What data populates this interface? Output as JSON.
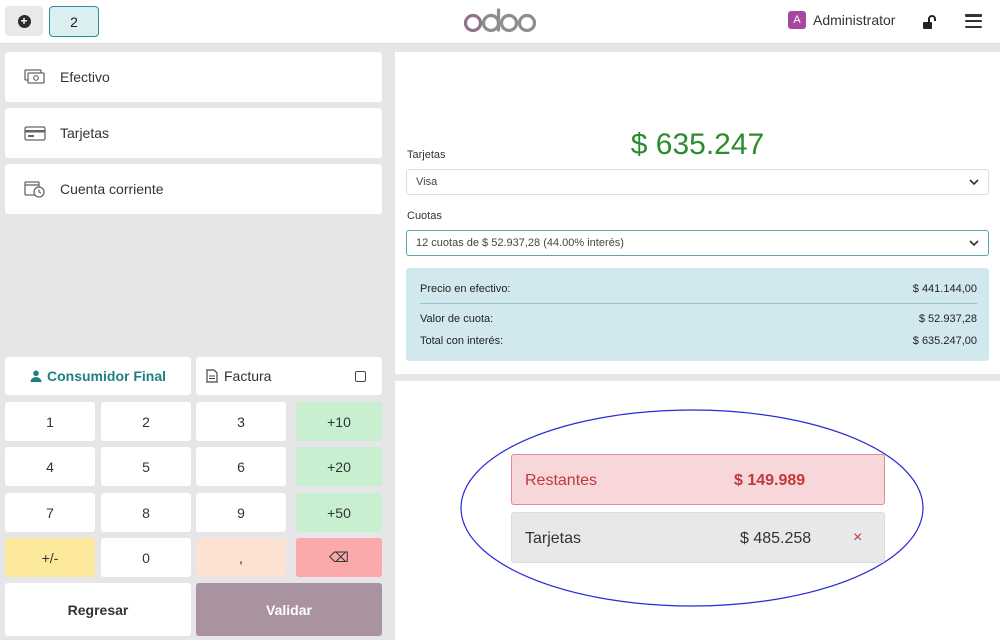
{
  "header": {
    "new_order_icon": "plus-circle-icon",
    "order_tab": "2",
    "logo": "odoo",
    "user_initial": "A",
    "user_name": "Administrator",
    "lock_icon": "lock-open-icon",
    "menu_icon": "hamburger-menu-icon"
  },
  "payment_methods": [
    {
      "label": "Efectivo",
      "icon": "cash-icon"
    },
    {
      "label": "Tarjetas",
      "icon": "card-icon"
    },
    {
      "label": "Cuenta corriente",
      "icon": "account-clock-icon"
    }
  ],
  "customer_label": "Consumidor Final",
  "invoice_label": "Factura",
  "numpad": {
    "k1": "1",
    "k2": "2",
    "k3": "3",
    "p10": "+10",
    "k4": "4",
    "k5": "5",
    "k6": "6",
    "p20": "+20",
    "k7": "7",
    "k8": "8",
    "k9": "9",
    "p50": "+50",
    "sign": "+/-",
    "k0": "0",
    "comma": ",",
    "backspace": "⌫"
  },
  "back_label": "Regresar",
  "validate_label": "Validar",
  "total": "$ 635.247",
  "card_field": {
    "label": "Tarjetas",
    "value": "Visa"
  },
  "quotas_field": {
    "label": "Cuotas",
    "value": "12 cuotas de $ 52.937,28 (44.00% interés)"
  },
  "summary": {
    "cash_price_label": "Precio en efectivo:",
    "cash_price_value": "$ 441.144,00",
    "quota_value_label": "Valor de cuota:",
    "quota_value_value": "$ 52.937,28",
    "total_interest_label": "Total con interés:",
    "total_interest_value": "$ 635.247,00"
  },
  "remaining": {
    "label": "Restantes",
    "value": "$ 149.989"
  },
  "payment_line": {
    "label": "Tarjetas",
    "value": "$ 485.258",
    "remove": "×"
  },
  "colors": {
    "accent": "#1f7f84",
    "total_green": "#2a8d2b",
    "remaining_red": "#c0393b",
    "validate": "#a993a1"
  }
}
